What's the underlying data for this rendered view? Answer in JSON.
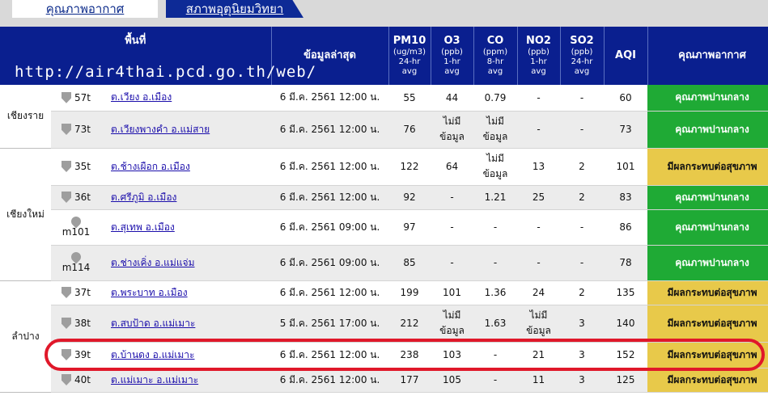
{
  "tabs": [
    "คุณภาพอากาศ",
    "สภาพอุตุนิยมวิทยา"
  ],
  "url": "http://air4thai.pcd.go.th/web/",
  "headers": {
    "area": "พื้นที่",
    "latest": "ข้อมูลล่าสุด",
    "pm10": {
      "name": "PM10",
      "unit": "(ug/m3)",
      "avg": "24-hr",
      "avg2": "avg"
    },
    "o3": {
      "name": "O3",
      "unit": "(ppb)",
      "avg": "1-hr",
      "avg2": "avg"
    },
    "co": {
      "name": "CO",
      "unit": "(ppm)",
      "avg": "8-hr",
      "avg2": "avg"
    },
    "no2": {
      "name": "NO2",
      "unit": "(ppb)",
      "avg": "1-hr",
      "avg2": "avg"
    },
    "so2": {
      "name": "SO2",
      "unit": "(ppb)",
      "avg": "24-hr",
      "avg2": "avg"
    },
    "aqi": "AQI",
    "quality": "คุณภาพอากาศ"
  },
  "provinces": [
    {
      "name": "เชียงราย"
    },
    {
      "name": "เชียงใหม่"
    },
    {
      "name": "ลำปาง"
    }
  ],
  "rows": [
    {
      "id": "57t",
      "station": "ต.เวียง อ.เมือง",
      "time": "6 มี.ค. 2561 12:00 น.",
      "pm10": "55",
      "o3": "44",
      "co": "0.79",
      "no2": "-",
      "so2": "-",
      "aqi": "60",
      "quality": "คุณภาพปานกลาง"
    },
    {
      "id": "73t",
      "station": "ต.เวียงพางคำ อ.แม่สาย",
      "time": "6 มี.ค. 2561 12:00 น.",
      "pm10": "76",
      "o3": "ไม่มี ข้อมูล",
      "co": "ไม่มี ข้อมูล",
      "no2": "-",
      "so2": "-",
      "aqi": "73",
      "quality": "คุณภาพปานกลาง"
    },
    {
      "id": "35t",
      "station": "ต.ช้างเผือก อ.เมือง",
      "time": "6 มี.ค. 2561 12:00 น.",
      "pm10": "122",
      "o3": "64",
      "co": "ไม่มี ข้อมูล",
      "no2": "13",
      "so2": "2",
      "aqi": "101",
      "quality": "มีผลกระทบต่อสุขภาพ"
    },
    {
      "id": "36t",
      "station": "ต.ศรีภูมิ อ.เมือง",
      "time": "6 มี.ค. 2561 12:00 น.",
      "pm10": "92",
      "o3": "-",
      "co": "1.21",
      "no2": "25",
      "so2": "2",
      "aqi": "83",
      "quality": "คุณภาพปานกลาง"
    },
    {
      "id": "m101",
      "station": "ต.สุเทพ อ.เมือง",
      "time": "6 มี.ค. 2561 09:00 น.",
      "pm10": "97",
      "o3": "-",
      "co": "-",
      "no2": "-",
      "so2": "-",
      "aqi": "86",
      "quality": "คุณภาพปานกลาง"
    },
    {
      "id": "m114",
      "station": "ต.ช่างเคิ่ง อ.แม่แจ่ม",
      "time": "6 มี.ค. 2561 09:00 น.",
      "pm10": "85",
      "o3": "-",
      "co": "-",
      "no2": "-",
      "so2": "-",
      "aqi": "78",
      "quality": "คุณภาพปานกลาง"
    },
    {
      "id": "37t",
      "station": "ต.พระบาท อ.เมือง",
      "time": "6 มี.ค. 2561 12:00 น.",
      "pm10": "199",
      "o3": "101",
      "co": "1.36",
      "no2": "24",
      "so2": "2",
      "aqi": "135",
      "quality": "มีผลกระทบต่อสุขภาพ"
    },
    {
      "id": "38t",
      "station": "ต.สบป้าด อ.แม่เมาะ",
      "time": "5 มี.ค. 2561 17:00 น.",
      "pm10": "212",
      "o3": "ไม่มี ข้อมูล",
      "co": "1.63",
      "no2": "ไม่มี ข้อมูล",
      "so2": "3",
      "aqi": "140",
      "quality": "มีผลกระทบต่อสุขภาพ"
    },
    {
      "id": "39t",
      "station": "ต.บ้านดง อ.แม่เมาะ",
      "time": "6 มี.ค. 2561 12:00 น.",
      "pm10": "238",
      "o3": "103",
      "co": "-",
      "no2": "21",
      "so2": "3",
      "aqi": "152",
      "quality": "มีผลกระทบต่อสุขภาพ"
    },
    {
      "id": "40t",
      "station": "ต.แม่เมาะ อ.แม่เมาะ",
      "time": "6 มี.ค. 2561 12:00 น.",
      "pm10": "177",
      "o3": "105",
      "co": "-",
      "no2": "11",
      "so2": "3",
      "aqi": "125",
      "quality": "มีผลกระทบต่อสุขภาพ"
    }
  ],
  "colors": {
    "good": "#1faa35",
    "moderate": "#e8c94a",
    "header": "#0a1f8f",
    "highlight": "#e0182a"
  }
}
